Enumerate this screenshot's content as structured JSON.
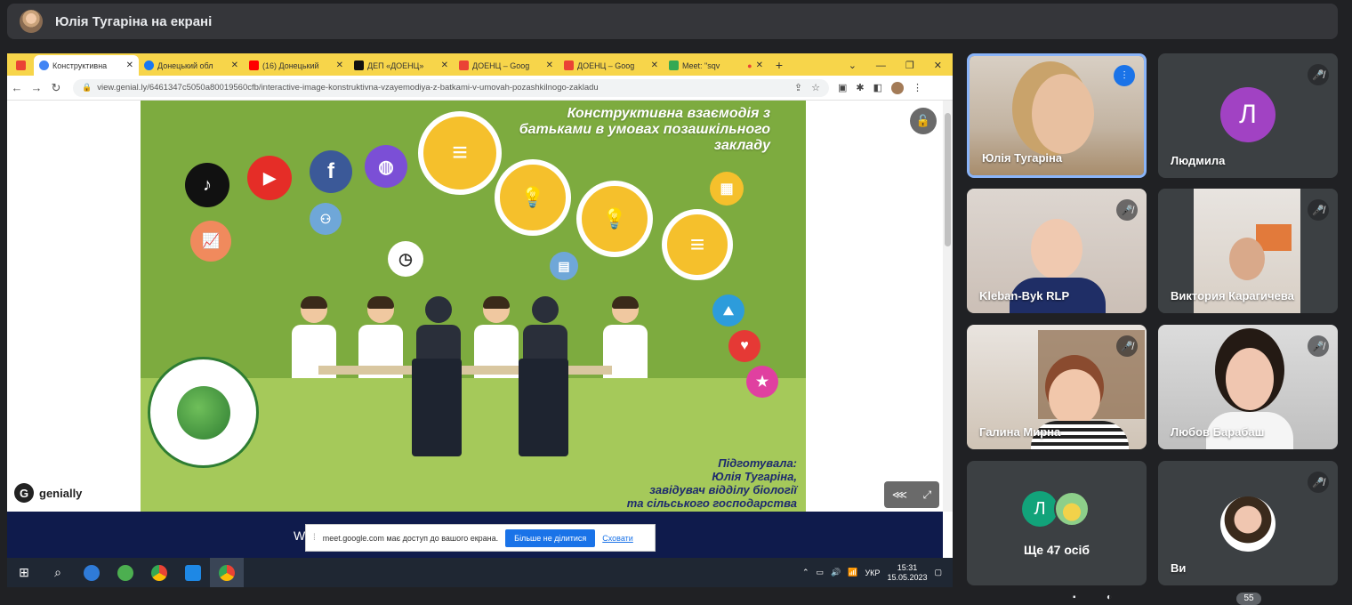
{
  "meet": {
    "presenter_banner": "Юлія Тугаріна на екрані"
  },
  "browser": {
    "tabs": [
      {
        "title": "Конструктивна",
        "color": "#4285f4"
      },
      {
        "title": "Донецький обл",
        "color": "#1877f2"
      },
      {
        "title": "(16) Донецький",
        "color": "#ff0000"
      },
      {
        "title": "ДЕП «ДОЕНЦ»",
        "color": "#111111"
      },
      {
        "title": "ДОЕНЦ – Goog",
        "color": "#ea4335"
      },
      {
        "title": "ДОЕНЦ – Goog",
        "color": "#ea4335"
      },
      {
        "title": "Meet: \"sqv",
        "color": "#34a853"
      }
    ],
    "url": "view.genial.ly/6461347c5050a80019560cfb/interactive-image-konstruktivna-vzayemodiya-z-batkami-v-umovah-pozashkilnogo-zakladu"
  },
  "slide": {
    "title": "Конструктивна взаємодія з батьками в умовах позашкільного закладу",
    "credits_line1": "Підготувала:",
    "credits_line2": "Юлія Тугаріна,",
    "credits_line3": "завідувач відділу біології",
    "credits_line4": "та сільського господарства",
    "brand": "genially"
  },
  "share_notice": {
    "text": "meet.google.com має доступ до вашого екрана.",
    "stop_label": "Більше не ділитися",
    "hide_label": "Сховати",
    "w_letter": "W"
  },
  "taskbar": {
    "lang": "УКР",
    "time": "15:31",
    "date": "15.05.2023"
  },
  "participants": [
    {
      "name": "Юлія Тугаріна"
    },
    {
      "name": "Людмила",
      "initial": "Л",
      "color": "#a142c3"
    },
    {
      "name": "Kleban-Byk RLP"
    },
    {
      "name": "Виктория Карагичева"
    },
    {
      "name": "Галина Мирна"
    },
    {
      "name": "Любов Барабаш"
    },
    {
      "name": "Ще 47 осіб",
      "initial": "Л"
    },
    {
      "name": "Ви"
    }
  ],
  "bottom": {
    "count": "55"
  }
}
